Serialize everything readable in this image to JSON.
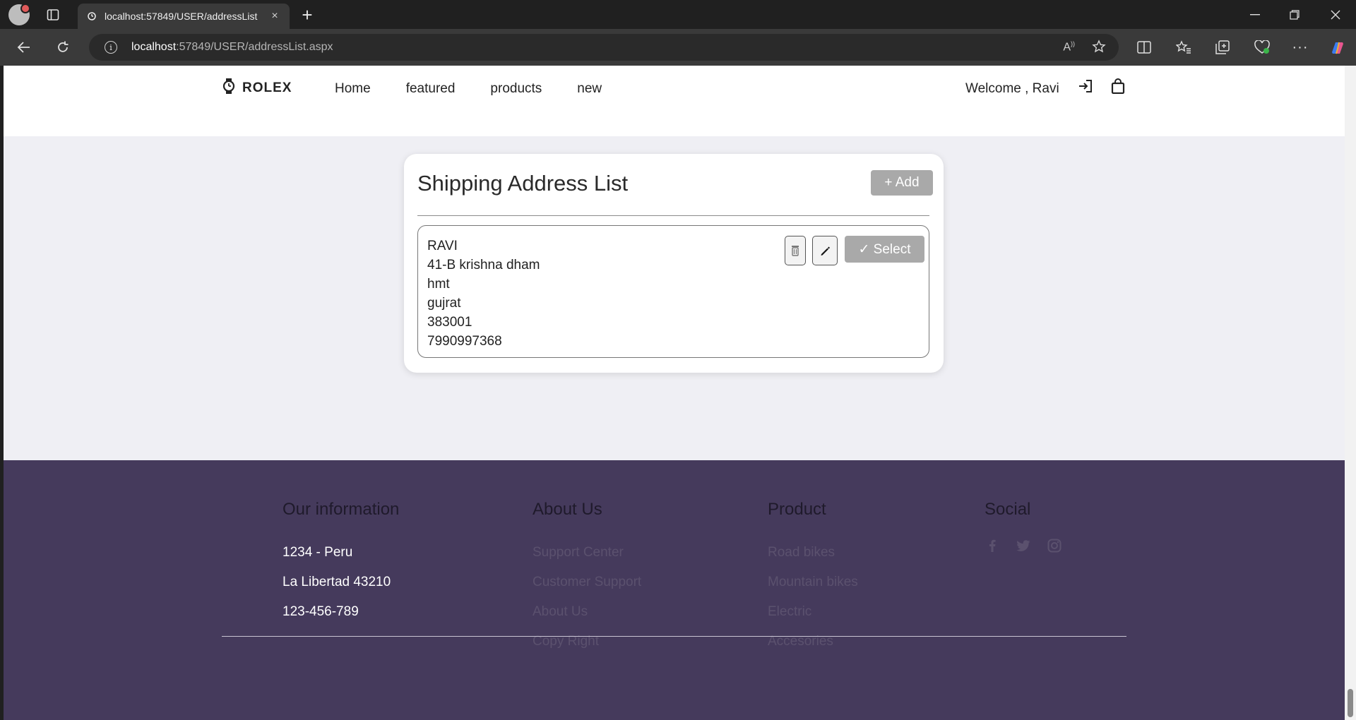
{
  "browser": {
    "tab_title": "localhost:57849/USER/addressList",
    "tab_close": "×",
    "new_tab": "+",
    "url_host": "localhost",
    "url_path": ":57849/USER/addressList.aspx",
    "info_glyph": "i"
  },
  "header": {
    "logo_text": "ROLEX",
    "nav": [
      "Home",
      "featured",
      "products",
      "new"
    ],
    "welcome_text": "Welcome , Ravi"
  },
  "address_card": {
    "title": "Shipping Address List",
    "add_label": "+ Add",
    "select_label": "✓ Select",
    "address": {
      "name": "RAVI",
      "line1": "41-B krishna dham",
      "city": "hmt",
      "state": "gujrat",
      "pincode": "383001",
      "phone": "7990997368"
    }
  },
  "footer": {
    "info": {
      "heading": "Our information",
      "items": [
        "1234 - Peru",
        "La Libertad 43210",
        "123-456-789"
      ]
    },
    "about": {
      "heading": "About Us",
      "items": [
        "Support Center",
        "Customer Support",
        "About Us",
        "Copy Right"
      ]
    },
    "product": {
      "heading": "Product",
      "items": [
        "Road bikes",
        "Mountain bikes",
        "Electric",
        "Accesories"
      ]
    },
    "social": {
      "heading": "Social",
      "icons": [
        "facebook-icon",
        "twitter-icon",
        "instagram-icon"
      ]
    }
  },
  "colors": {
    "footer_bg": "#453a5c",
    "page_bg": "#efeff4",
    "button_gray": "#a9a9a9"
  }
}
